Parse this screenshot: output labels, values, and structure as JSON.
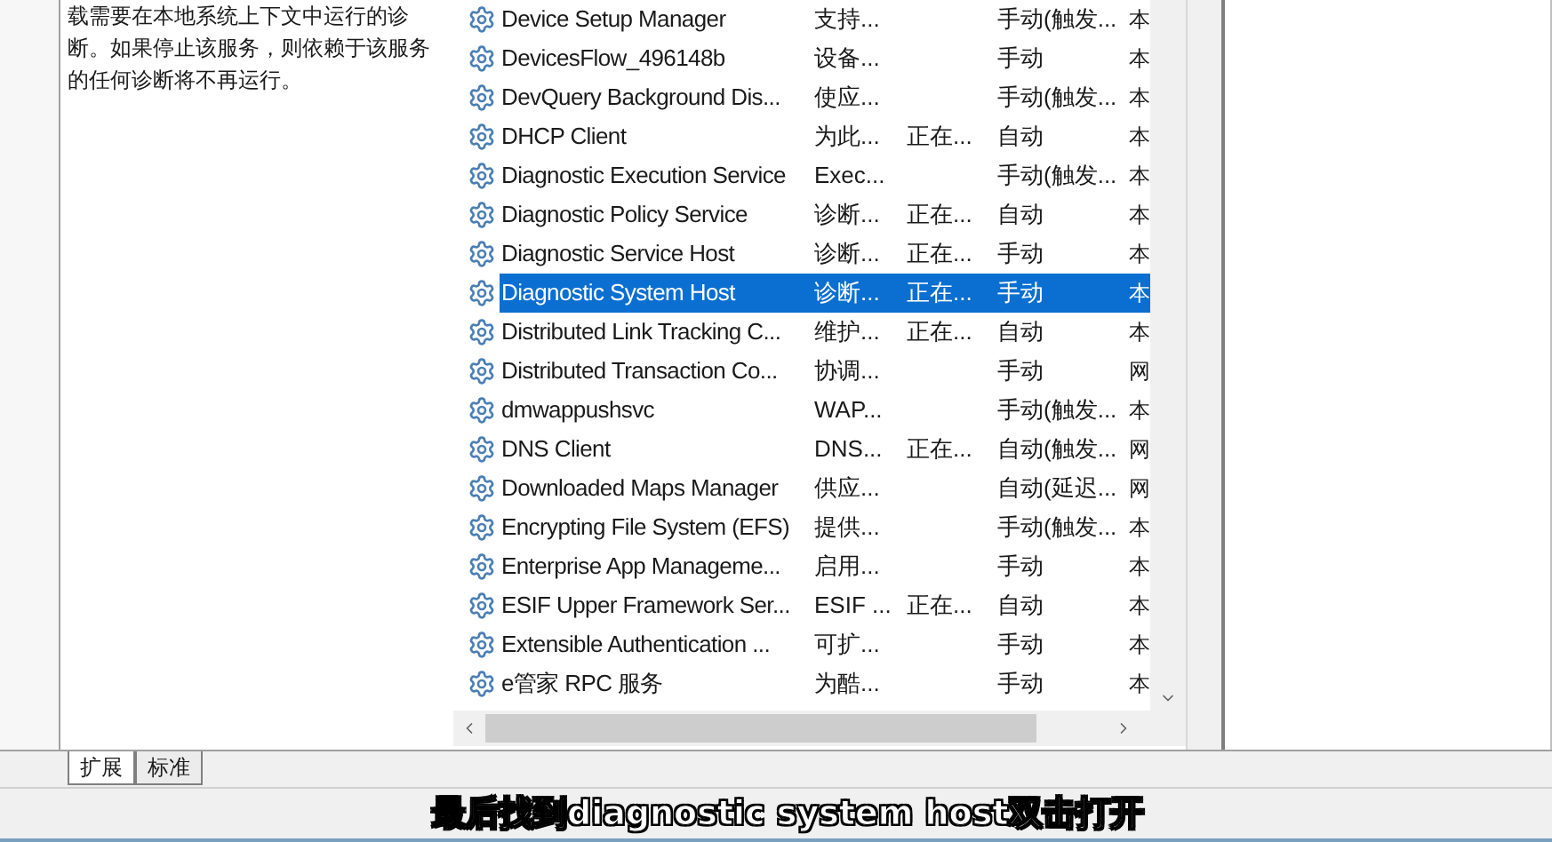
{
  "description": "载需要在本地系统上下文中运行的诊断。如果停止该服务，则依赖于该服务的任何诊断将不再运行。",
  "services": [
    {
      "name": "Device Setup Manager",
      "description": "支持...",
      "startup": "手动(触发...",
      "logon": "本",
      "selected": false
    },
    {
      "name": "DevicesFlow_496148b",
      "description": "设备...",
      "startup": "手动",
      "logon": "本",
      "selected": false
    },
    {
      "name": "DevQuery Background Dis...",
      "description": "使应...",
      "startup": "手动(触发...",
      "logon": "本",
      "selected": false
    },
    {
      "name": "DHCP Client",
      "description": "为此...",
      "status": "正在...",
      "startup": "自动",
      "logon": "本",
      "selected": false
    },
    {
      "name": "Diagnostic Execution Service",
      "description": "Exec...",
      "startup": "手动(触发...",
      "logon": "本",
      "selected": false
    },
    {
      "name": "Diagnostic Policy Service",
      "description": "诊断...",
      "status": "正在...",
      "startup": "自动",
      "logon": "本",
      "selected": false
    },
    {
      "name": "Diagnostic Service Host",
      "description": "诊断...",
      "status": "正在...",
      "startup": "手动",
      "logon": "本",
      "selected": false
    },
    {
      "name": "Diagnostic System Host",
      "description": "诊断...",
      "status": "正在...",
      "startup": "手动",
      "logon": "本",
      "selected": true
    },
    {
      "name": "Distributed Link Tracking C...",
      "description": "维护...",
      "status": "正在...",
      "startup": "自动",
      "logon": "本",
      "selected": false
    },
    {
      "name": "Distributed Transaction Co...",
      "description": "协调...",
      "startup": "手动",
      "logon": "网",
      "selected": false
    },
    {
      "name": "dmwappushsvc",
      "description": "WAP...",
      "startup": "手动(触发...",
      "logon": "本",
      "selected": false
    },
    {
      "name": "DNS Client",
      "description": "DNS...",
      "status": "正在...",
      "startup": "自动(触发...",
      "logon": "网",
      "selected": false
    },
    {
      "name": "Downloaded Maps Manager",
      "description": "供应...",
      "startup": "自动(延迟...",
      "logon": "网",
      "selected": false
    },
    {
      "name": "Encrypting File System (EFS)",
      "description": "提供...",
      "startup": "手动(触发...",
      "logon": "本",
      "selected": false
    },
    {
      "name": "Enterprise App Manageme...",
      "description": "启用...",
      "startup": "手动",
      "logon": "本",
      "selected": false
    },
    {
      "name": "ESIF Upper Framework Ser...",
      "description": "ESIF ...",
      "status": "正在...",
      "startup": "自动",
      "logon": "本",
      "selected": false
    },
    {
      "name": "Extensible Authentication ...",
      "description": "可扩...",
      "startup": "手动",
      "logon": "本",
      "selected": false
    },
    {
      "name": "e管家 RPC 服务",
      "description": "为酷...",
      "startup": "手动",
      "logon": "本",
      "selected": false
    }
  ],
  "tabs": [
    {
      "label": "扩展",
      "selected": true
    },
    {
      "label": "标准",
      "selected": false
    }
  ],
  "subtitle": "最后找到diagnostic system host双击打开"
}
